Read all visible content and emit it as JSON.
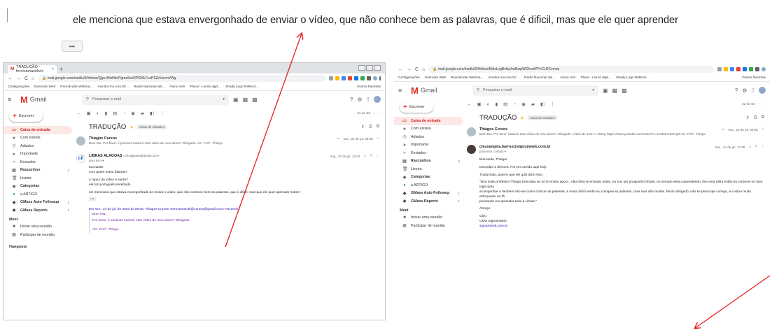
{
  "caption": {
    "text": "ele menciona que estava envergonhado de enviar o vídeo, que não conhece bem as palavras, que é dificil, mas que ele quer aprender",
    "more_label": "•••"
  },
  "colors": {
    "annotation_arrow": "#e32020",
    "gmail_red": "#d93025",
    "active_nav_bg": "#fce8e6"
  },
  "left_shot": {
    "tab_title": "TRADUÇÃO - fernicamaxelivix",
    "url": "mail.google.com/mail/u/0/#inbox/QgrcJHsHbvPgmzSxxRPGMLFvxPSZvVsvmVWg",
    "bookmarks": [
      "Configurações",
      "Evernote Web",
      "Roundcube Webma...",
      "monitor.mv.com.br/...",
      "Radio Nacional del...",
      "Aluno AVA",
      "Plural - Livros digit...",
      "Shady Logo Reflecti...",
      "Outros favoritos"
    ],
    "search_placeholder": "Pesquisar e-mail",
    "compose_label": "Escrever",
    "nav": [
      {
        "label": "Caixa de entrada",
        "count": "",
        "icon": "inbox-icon",
        "glyph": "▭",
        "active": true,
        "bold": true
      },
      {
        "label": "Com estrela",
        "count": "",
        "icon": "star-icon",
        "glyph": "★",
        "active": false,
        "bold": false
      },
      {
        "label": "Adiados",
        "count": "",
        "icon": "clock-icon",
        "glyph": "◷",
        "active": false,
        "bold": false
      },
      {
        "label": "Importante",
        "count": "",
        "icon": "important-icon",
        "glyph": "➤",
        "active": false,
        "bold": false
      },
      {
        "label": "Enviados",
        "count": "",
        "icon": "send-icon",
        "glyph": "➢",
        "active": false,
        "bold": false
      },
      {
        "label": "Rascunhos",
        "count": "4",
        "icon": "draft-icon",
        "glyph": "▤",
        "active": false,
        "bold": true
      },
      {
        "label": "Lixeira",
        "count": "",
        "icon": "trash-icon",
        "glyph": "🗑",
        "active": false,
        "bold": false
      },
      {
        "label": "Categorias",
        "count": "",
        "icon": "label-icon",
        "glyph": "◆",
        "active": false,
        "bold": true
      },
      {
        "label": "a ARTIGO",
        "count": "",
        "icon": "label-green-icon",
        "glyph": "●",
        "active": false,
        "bold": false
      },
      {
        "label": "GMass Auto Followup",
        "count": "1",
        "icon": "label-dark-icon",
        "glyph": "◆",
        "active": false,
        "bold": true
      },
      {
        "label": "GMass Reports",
        "count": "1",
        "icon": "label-dark-icon",
        "glyph": "◆",
        "active": false,
        "bold": true
      }
    ],
    "meet_label": "Meet",
    "meet_items": [
      "Iniciar uma reunião",
      "Participar de reunião"
    ],
    "hangouts_label": "Hangouts",
    "pager": "21 de 83",
    "subject": "TRADUÇÃO",
    "label_chip": "Caixa de entrada x",
    "msg1": {
      "from": "Thiagos Cursos",
      "snippet": "Bom Dia, Por favor, é possível traduzir este video de meu aluno? Obrigado. Att.: Prof.: Thiago.",
      "date": "sex., 24 de jul. 09:06"
    },
    "msg2": {
      "from": "LIBRAS ALAGOAS",
      "from_addr": "<cil.alagoas@gmail.com>",
      "to": "para mim ▾",
      "date": "seg., 27 de jul. 13:42",
      "lines": [
        "boa tarde.",
        "com quem estou falando?",
        "",
        "o rapaz do vídeo é surdo?",
        "ele faz português sinalizado.",
        "",
        "ele menciona que estava envergonhado de enviar o vídeo, que não conhece bem as palavras, que é difícil, mas que ele quer aprender sobre l"
      ],
      "ellipsis": "•••"
    },
    "quote": {
      "header": "Em sex., 24 de jul. de 2020 às 09:06, Thiagos Cursos <teresamaciel@cursos@gmail.com> escreveu:",
      "lines": [
        "Bom Dia,",
        "Por favor, é possível traduzir este vídeo de meu aluno? Obrigado.",
        "",
        "Att.: Prof.: Thiago."
      ]
    }
  },
  "right_shot": {
    "url": "mail.google.com/mail/u/0/#inbox/KtbxLvgBvhpJrwBzqrWGhcmPPcCLRCvmvq",
    "bookmarks": [
      "Configurações",
      "Evernote Web",
      "Roundcube Webma...",
      "monitor.mv.com.br/...",
      "Radio Nacional del...",
      "Aluno AVA",
      "Plural - Livros digit...",
      "Shady Logo Reflecti...",
      "Outros favoritos"
    ],
    "search_placeholder": "Pesquisar e-mail",
    "compose_label": "Escrever",
    "nav": [
      {
        "label": "Caixa de entrada",
        "count": "",
        "icon": "inbox-icon",
        "glyph": "▭",
        "active": true,
        "bold": true
      },
      {
        "label": "Com estrela",
        "count": "",
        "icon": "star-icon",
        "glyph": "★",
        "active": false,
        "bold": false
      },
      {
        "label": "Adiados",
        "count": "",
        "icon": "clock-icon",
        "glyph": "◷",
        "active": false,
        "bold": false
      },
      {
        "label": "Importante",
        "count": "",
        "icon": "important-icon",
        "glyph": "➤",
        "active": false,
        "bold": false
      },
      {
        "label": "Enviados",
        "count": "",
        "icon": "send-icon",
        "glyph": "➢",
        "active": false,
        "bold": false
      },
      {
        "label": "Rascunhos",
        "count": "4",
        "icon": "draft-icon",
        "glyph": "▤",
        "active": false,
        "bold": true
      },
      {
        "label": "Lixeira",
        "count": "",
        "icon": "trash-icon",
        "glyph": "🗑",
        "active": false,
        "bold": false
      },
      {
        "label": "Categorias",
        "count": "",
        "icon": "label-icon",
        "glyph": "◆",
        "active": false,
        "bold": true
      },
      {
        "label": "a ARTIGO",
        "count": "",
        "icon": "label-green-icon",
        "glyph": "●",
        "active": false,
        "bold": false
      },
      {
        "label": "GMass Auto Followup",
        "count": "1",
        "icon": "label-dark-icon",
        "glyph": "◆",
        "active": false,
        "bold": true
      },
      {
        "label": "GMass Reports",
        "count": "1",
        "icon": "label-dark-icon",
        "glyph": "◆",
        "active": false,
        "bold": true
      }
    ],
    "meet_label": "Meet",
    "meet_items": [
      "Iniciar uma reunião",
      "Participar de reunião"
    ],
    "pager": "32 de 83",
    "subject": "TRADUÇÃO",
    "label_chip": "Caixa de entrada x",
    "msg1": {
      "from": "Thiagos Cursos",
      "snippet": "Bom Dia, Por favor, traduzir este vídeo de meu aluno? Obrigado. Vídeo de 1min e 16seg https://www.youtube.com/watch?v=L0GbtnAEcPyM Att.: Prof.: Thiago",
      "date": "sex., 24 de jul. 09:03"
    },
    "msg2": {
      "from": "cleusangela.barros@signumweb.com.br",
      "to": "para mim, contato ▾",
      "date": "sex., 24 de jul. 17:36",
      "lines": [
        "Boa tarde, Thiago!",
        "",
        "Desculpe a demora. Foi em corrido aqui hoje.",
        "",
        "Traduzindo, parece que ele quis dizer isso:",
        "",
        "\"Boa noite professor Thiago Desculpa eu só te enviar agora , não tinha te enviado antes, eu sou um pouquinho tímido, eu sempre estou aprendendo, tive uma ideia então eu comecei no meu login para",
        "acompanhar a também não sei como colocar as palavras, é muito difícil então eu coloquei as palavras, mas mas são muitas. Muito obrigado, não se preocupe comigo, eu estou muito esforçando ao fã",
        "pensando em aprender tudo a Libras.\"",
        "",
        "Abraço",
        "",
        "Cléo",
        "CMO SignumWeb",
        "signumweb.com.br"
      ]
    }
  }
}
